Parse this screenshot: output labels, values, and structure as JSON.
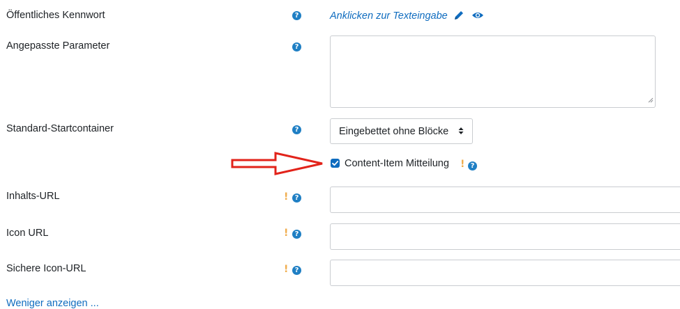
{
  "fields": {
    "public_password": {
      "label": "Öffentliches Kennwort",
      "link_text": "Anklicken zur Texteingabe"
    },
    "custom_params": {
      "label": "Angepasste Parameter",
      "value": ""
    },
    "launch_container": {
      "label": "Standard-Startcontainer",
      "selected": "Eingebettet ohne Blöcke"
    },
    "content_item": {
      "label": "Content-Item Mitteilung",
      "checked": true
    },
    "content_url": {
      "label": "Inhalts-URL",
      "value": ""
    },
    "icon_url": {
      "label": "Icon URL",
      "value": ""
    },
    "secure_icon_url": {
      "label": "Sichere Icon-URL",
      "value": ""
    }
  },
  "show_less_link": "Weniger anzeigen ...",
  "glyphs": {
    "help": "?",
    "required": "!"
  },
  "colors": {
    "link": "#0f6cbf",
    "help_icon": "#1f7fc4",
    "required": "#f0ad4e",
    "arrow": "#e2231a"
  }
}
